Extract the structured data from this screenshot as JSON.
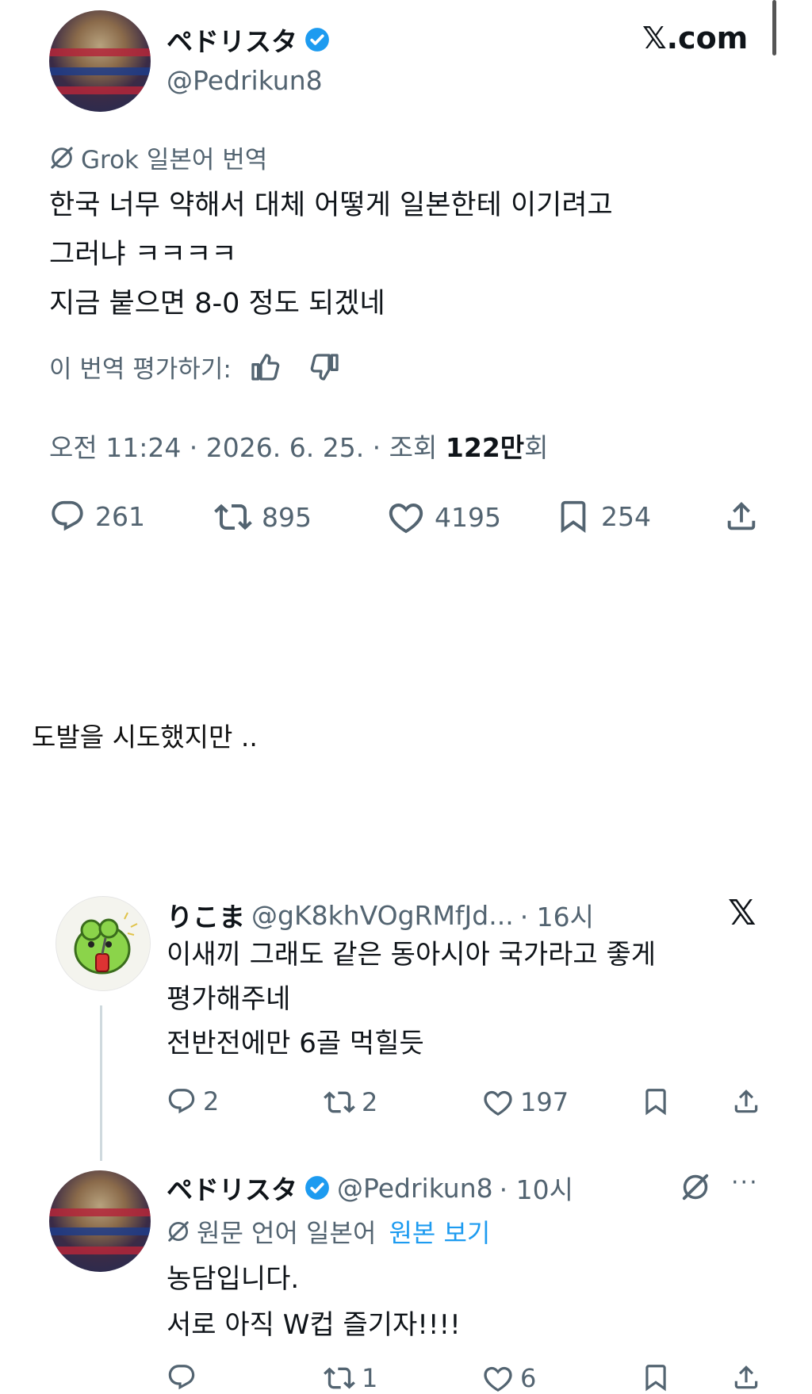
{
  "tweet": {
    "author_name": "ペドリスタ",
    "author_handle": "@Pedrikun8",
    "site_label": "𝕏.com",
    "translation_label": "Grok 일본어 번역",
    "body_lines": [
      "한국 너무 약해서 대체 어떻게 일본한테 이기려고",
      "그러냐 ㅋㅋㅋㅋ",
      "지금 붙으면 8-0 정도 되겠네"
    ],
    "rate_label": "이 번역 평가하기:",
    "meta_prefix": "오전 11:24 · 2026. 6. 25. · 조회 ",
    "views_value": "122만",
    "views_suffix": "회",
    "counts": {
      "replies": "261",
      "retweets": "895",
      "likes": "4195",
      "bookmarks": "254"
    }
  },
  "caption": "도발을 시도했지만 ..",
  "reply1": {
    "author_name": "りこま",
    "author_handle": "@gK8khVOgRMfJd...",
    "time": "· 16시",
    "body_lines": [
      "이새끼 그래도 같은 동아시아 국가라고 좋게",
      "평가해주네",
      "전반전에만 6골 먹힐듯"
    ],
    "counts": {
      "replies": "2",
      "retweets": "2",
      "likes": "197"
    }
  },
  "reply2": {
    "author_name": "ペドリスタ",
    "author_handle": "@Pedrikun8",
    "time": "· 10시",
    "translation_label": "원문 언어 일본어",
    "view_original": "원본 보기",
    "body_lines": [
      "농담입니다.",
      "서로 아직 W컵 즐기자!!!!"
    ],
    "counts": {
      "retweets": "1",
      "likes": "6"
    }
  },
  "colors": {
    "text": "#0f1419",
    "secondary": "#536471",
    "accent": "#1d9bf0",
    "background": "#ffffff"
  },
  "icons": [
    "grok-icon",
    "verified-badge-icon",
    "x-logo-icon",
    "reply-icon",
    "retweet-icon",
    "like-icon",
    "bookmark-icon",
    "share-icon",
    "thumbs-up-icon",
    "thumbs-down-icon",
    "more-icon"
  ]
}
